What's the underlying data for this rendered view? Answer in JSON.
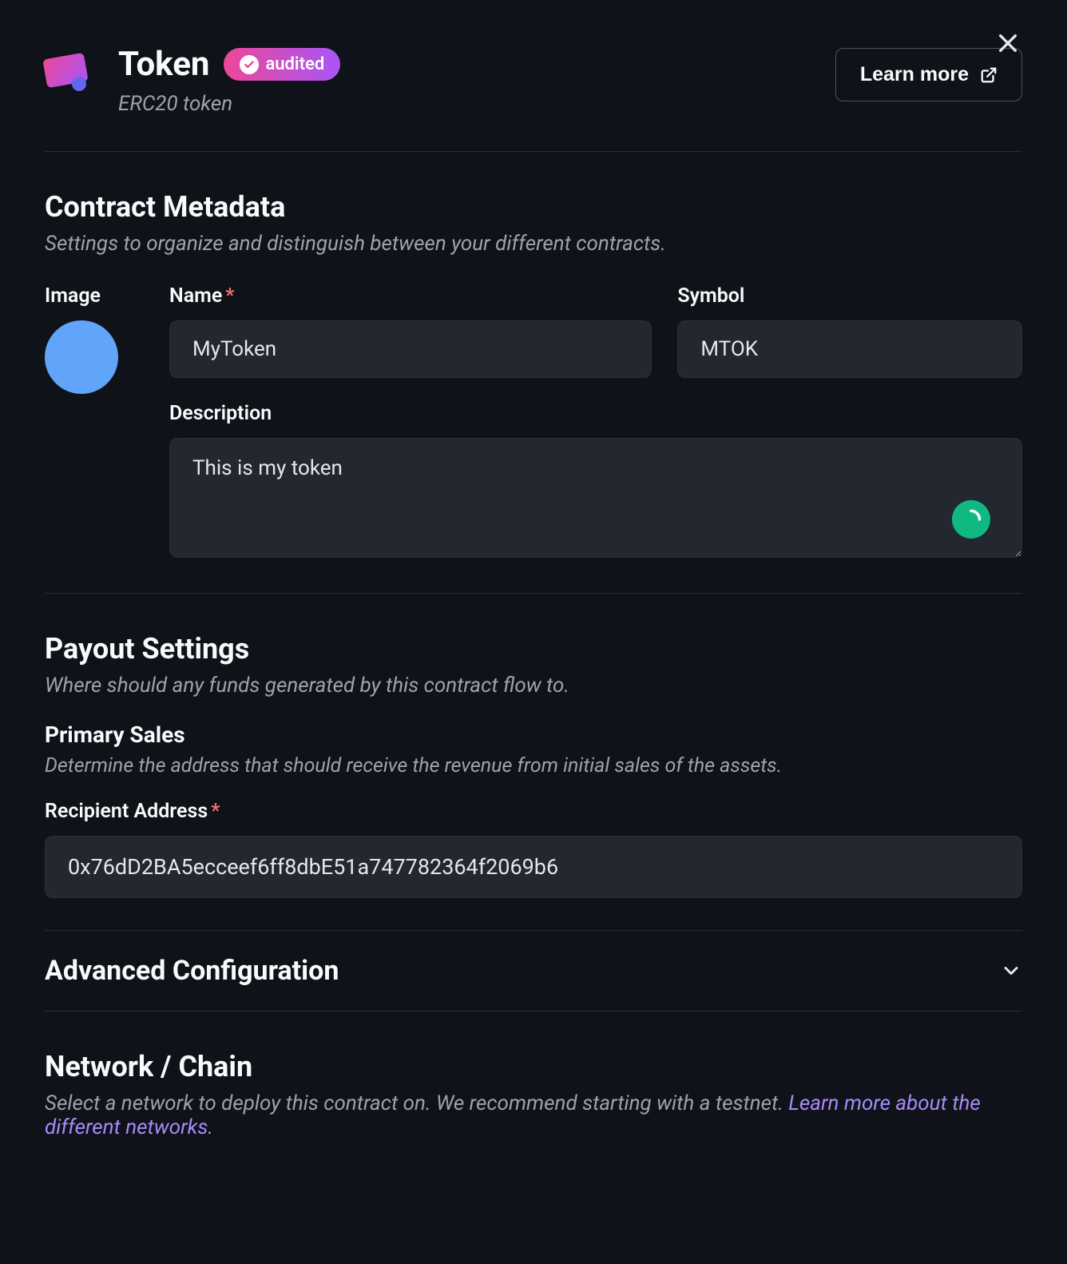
{
  "header": {
    "title": "Token",
    "badge": "audited",
    "subtitle": "ERC20 token",
    "learn_more": "Learn more"
  },
  "metadata": {
    "title": "Contract Metadata",
    "desc": "Settings to organize and distinguish between your different contracts.",
    "image_label": "Image",
    "name_label": "Name",
    "name_value": "MyToken",
    "symbol_label": "Symbol",
    "symbol_value": "MTOK",
    "description_label": "Description",
    "description_value": "This is my token"
  },
  "payout": {
    "title": "Payout Settings",
    "desc": "Where should any funds generated by this contract flow to.",
    "primary_title": "Primary Sales",
    "primary_desc": "Determine the address that should receive the revenue from initial sales of the assets.",
    "recipient_label": "Recipient Address",
    "recipient_value": "0x76dD2BA5ecceef6ff8dbE51a747782364f2069b6"
  },
  "advanced": {
    "title": "Advanced Configuration"
  },
  "network": {
    "title": "Network / Chain",
    "desc_part1": "Select a network to deploy this contract on. We recommend starting with a testnet. ",
    "link": "Learn more about the different networks."
  }
}
